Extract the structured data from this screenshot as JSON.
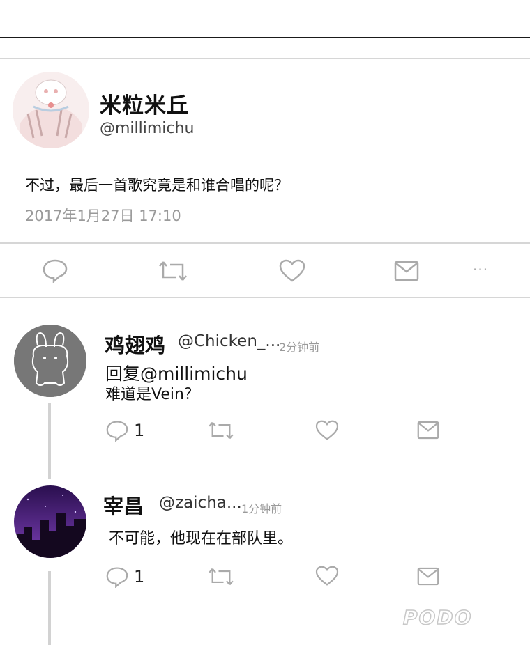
{
  "post": {
    "author_name": "米粒米丘",
    "author_handle": "@millimichu",
    "text": "不过，最后一首歌究竟是和谁合唱的呢？",
    "timestamp": "2017年1月27日 17:10",
    "actions": [
      "reply-icon",
      "retweet-icon",
      "like-icon",
      "message-icon",
      "more-icon"
    ],
    "more_label": "···"
  },
  "replies": [
    {
      "name": "鸡翅鸡",
      "handle": "@Chicken_...",
      "ago": "2分钟前",
      "reply_to": "回复@millimichu",
      "text": "难道是Vein？",
      "reply_count": "1"
    },
    {
      "name": "宰昌",
      "handle": "@zaicha...",
      "ago": "1分钟前",
      "text": "不可能，他现在在部队里。",
      "reply_count": "1"
    }
  ],
  "watermark": "PODO",
  "colors": {
    "icon": "#aaaaaa",
    "divider": "#d6d6d6",
    "muted_text": "#9a9a9a"
  }
}
